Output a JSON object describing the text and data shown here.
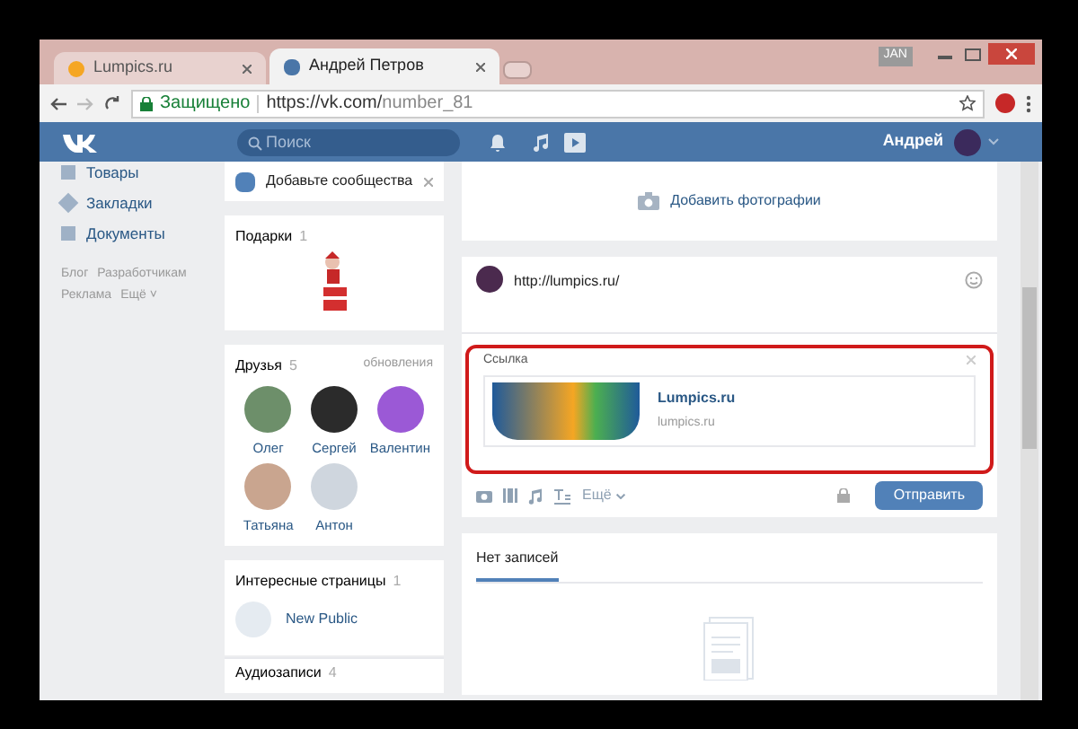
{
  "browser": {
    "tabs": [
      {
        "label": "Lumpics.ru",
        "selected": false
      },
      {
        "label": "Андрей Петров",
        "selected": true
      }
    ],
    "keyboard_indicator": "JAN",
    "address": {
      "secure_label": "Защищено",
      "url_host": "https://vk.com/",
      "url_path": "number_81"
    }
  },
  "header": {
    "search_placeholder": "Поиск",
    "user_name": "Андрей"
  },
  "left_nav": {
    "items": [
      "Товары",
      "Закладки",
      "Документы"
    ],
    "footer_links": [
      "Блог",
      "Разработчикам",
      "Реклама",
      "Ещё ˅"
    ]
  },
  "widgets": {
    "add_communities": "Добавьте сообщества",
    "gifts": {
      "title": "Подарки",
      "count": "1"
    },
    "friends": {
      "title": "Друзья",
      "count": "5",
      "action": "обновления",
      "people": [
        "Олег",
        "Сергей",
        "Валентин",
        "Татьяна",
        "Антон"
      ]
    },
    "pages": {
      "title": "Интересные страницы",
      "count": "1",
      "items": [
        "New Public"
      ]
    },
    "audio": {
      "title": "Аудиозаписи",
      "count": "4"
    }
  },
  "main": {
    "add_photos": "Добавить фотографии",
    "composer": {
      "text": "http://lumpics.ru/",
      "attachment": {
        "label": "Ссылка",
        "title": "Lumpics.ru",
        "domain": "lumpics.ru"
      },
      "more": "Ещё",
      "submit": "Отправить"
    },
    "wall": {
      "tab": "Нет записей"
    }
  }
}
